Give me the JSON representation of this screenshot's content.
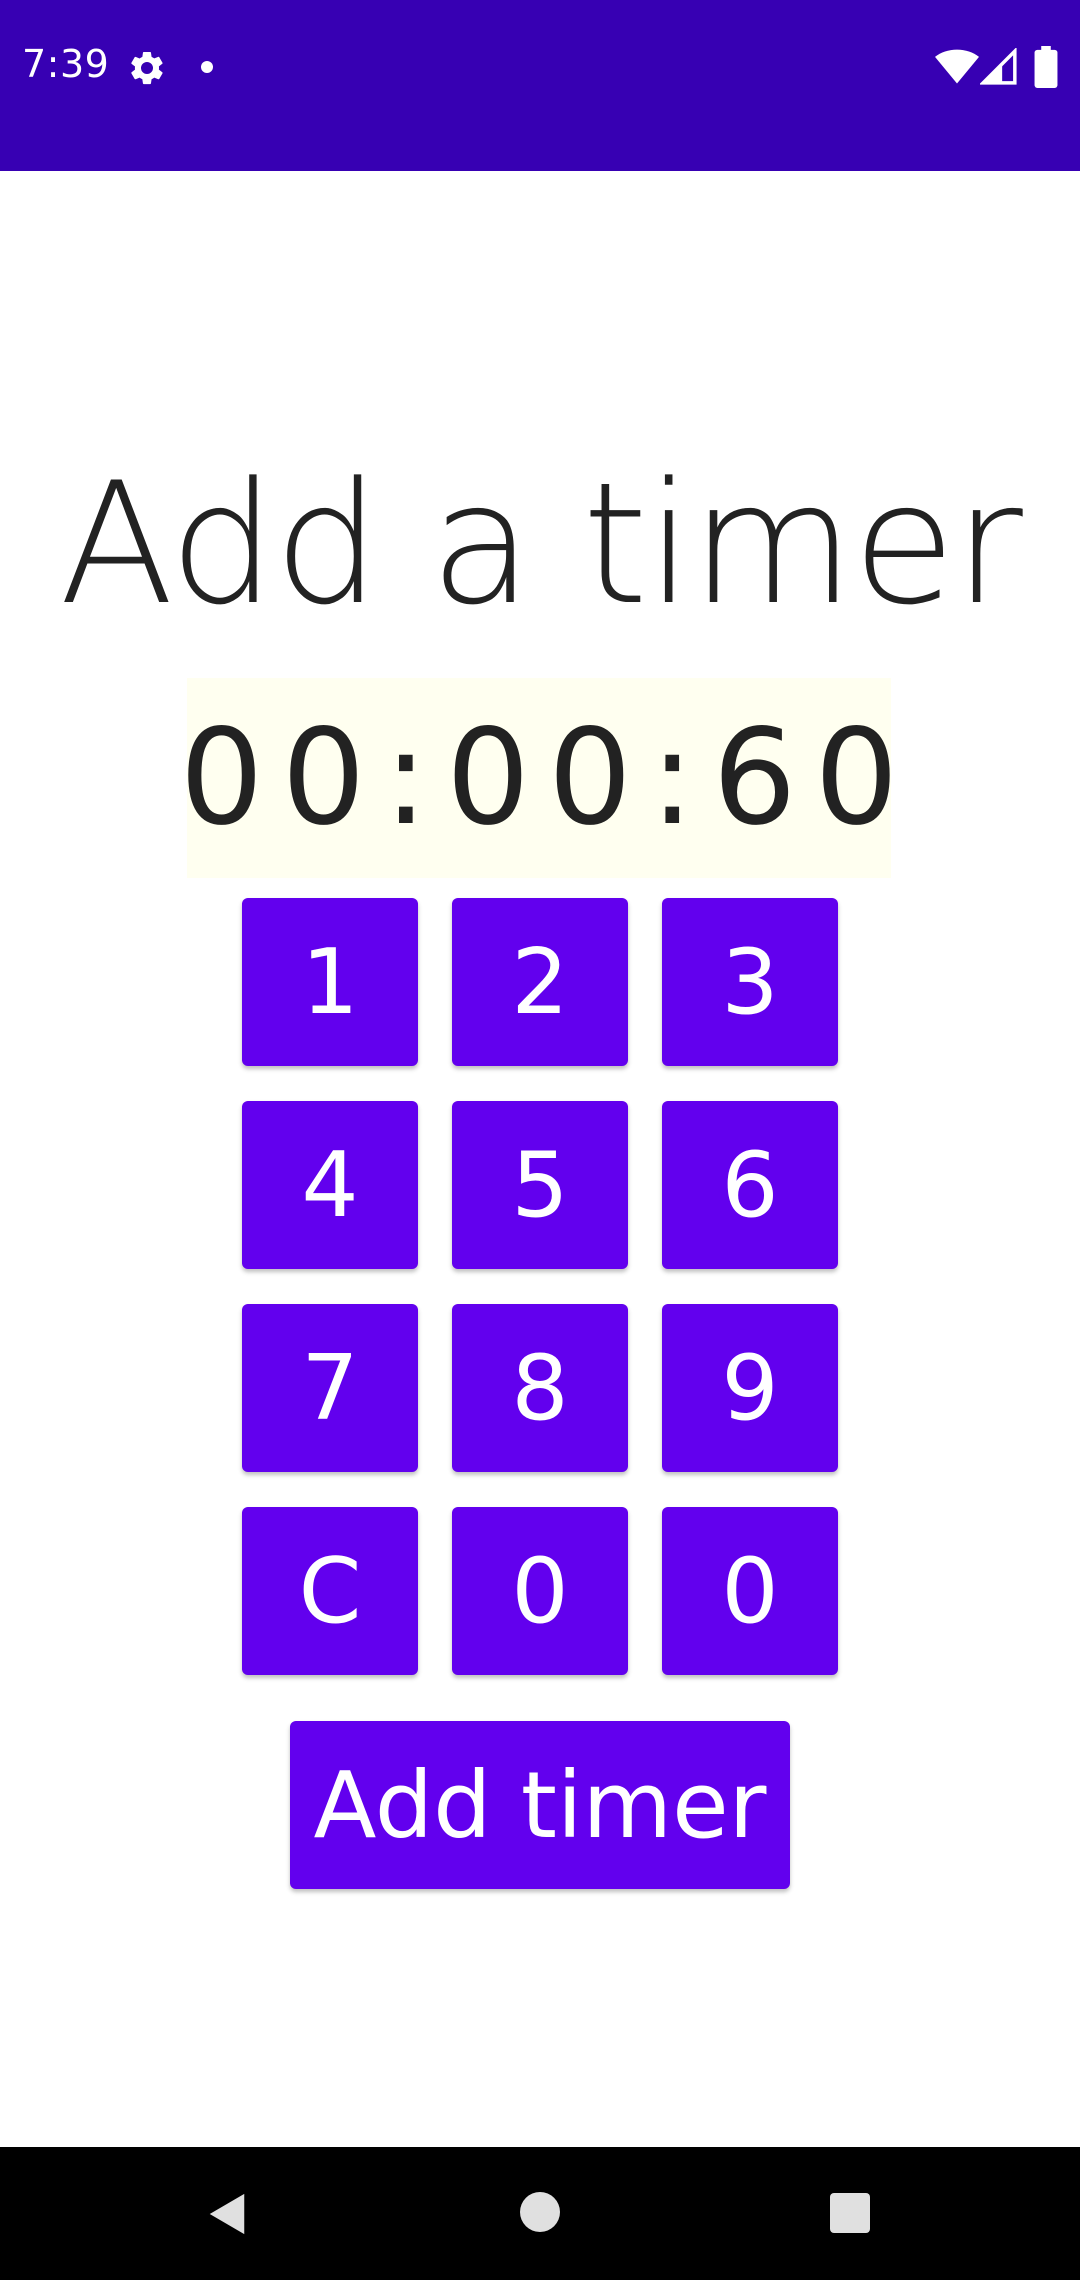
{
  "status_bar": {
    "time": "7:39",
    "background": "#3700b3",
    "icons": [
      "gear-icon",
      "notification-dot-icon",
      "wifi-icon",
      "cell-signal-icon",
      "battery-icon"
    ]
  },
  "title": "Add a timer",
  "timer_display": {
    "value": "00:00:60",
    "background": "#fffff0"
  },
  "keypad": {
    "keys": [
      "1",
      "2",
      "3",
      "4",
      "5",
      "6",
      "7",
      "8",
      "9",
      "C",
      "0",
      "0"
    ],
    "accent": "#6200ee"
  },
  "add_button_label": "Add timer",
  "nav_bar": {
    "icons": [
      "back-icon",
      "home-icon",
      "recents-icon"
    ]
  }
}
